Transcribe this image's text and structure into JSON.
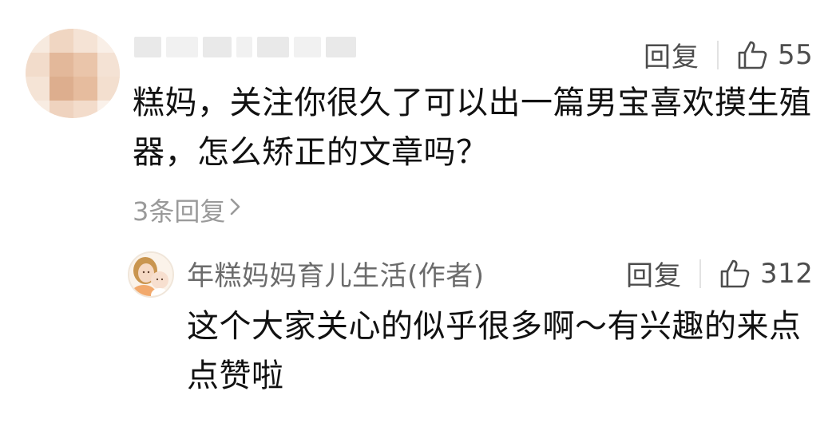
{
  "main_comment": {
    "reply_label": "回复",
    "like_count": "55",
    "text": "糕妈，关注你很久了可以出一篇男宝喜欢摸生殖器，怎么矫正的文章吗？",
    "replies_link": "3条回复"
  },
  "author_reply": {
    "author_name": "年糕妈妈育儿生活(作者)",
    "reply_label": "回复",
    "like_count": "312",
    "text": "这个大家关心的似乎很多啊～有兴趣的来点点赞啦"
  },
  "icons": {
    "like": "thumbs-up-icon",
    "chevron": "chevron-right-icon"
  },
  "colors": {
    "text_primary": "#111111",
    "text_secondary": "#4d4d4d",
    "text_muted": "#9a9a9a",
    "separator": "#e2e2e2"
  }
}
